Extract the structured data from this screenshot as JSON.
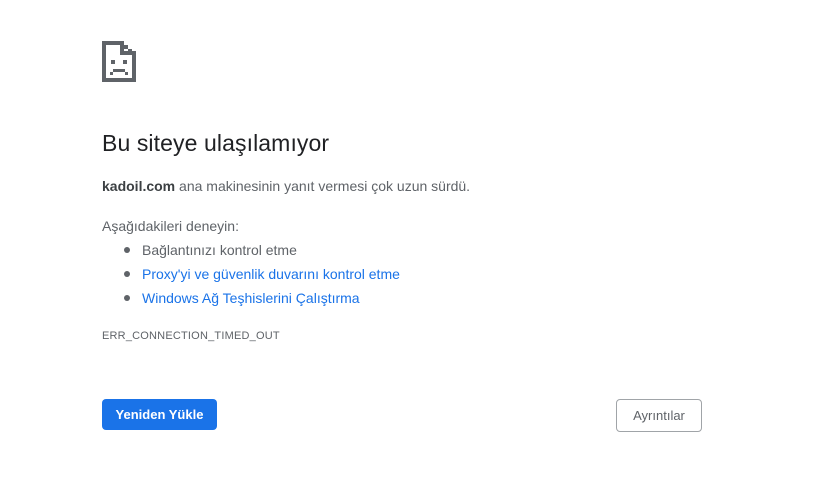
{
  "error": {
    "icon": "sad-page-icon",
    "title": "Bu siteye ulaşılamıyor",
    "host": "kadoil.com",
    "summary_rest": " ana makinesinin yanıt vermesi çok uzun sürdü.",
    "suggestions_label": "Aşağıdakileri deneyin:",
    "suggestions": [
      {
        "text": "Bağlantınızı kontrol etme",
        "link": false
      },
      {
        "text": "Proxy'yi ve güvenlik duvarını kontrol etme",
        "link": true
      },
      {
        "text": "Windows Ağ Teşhislerini Çalıştırma",
        "link": true
      }
    ],
    "code": "ERR_CONNECTION_TIMED_OUT"
  },
  "buttons": {
    "reload_label": "Yeniden Yükle",
    "details_label": "Ayrıntılar"
  },
  "colors": {
    "accent": "#1a73e8",
    "text": "#5f6368",
    "title": "#202124"
  }
}
